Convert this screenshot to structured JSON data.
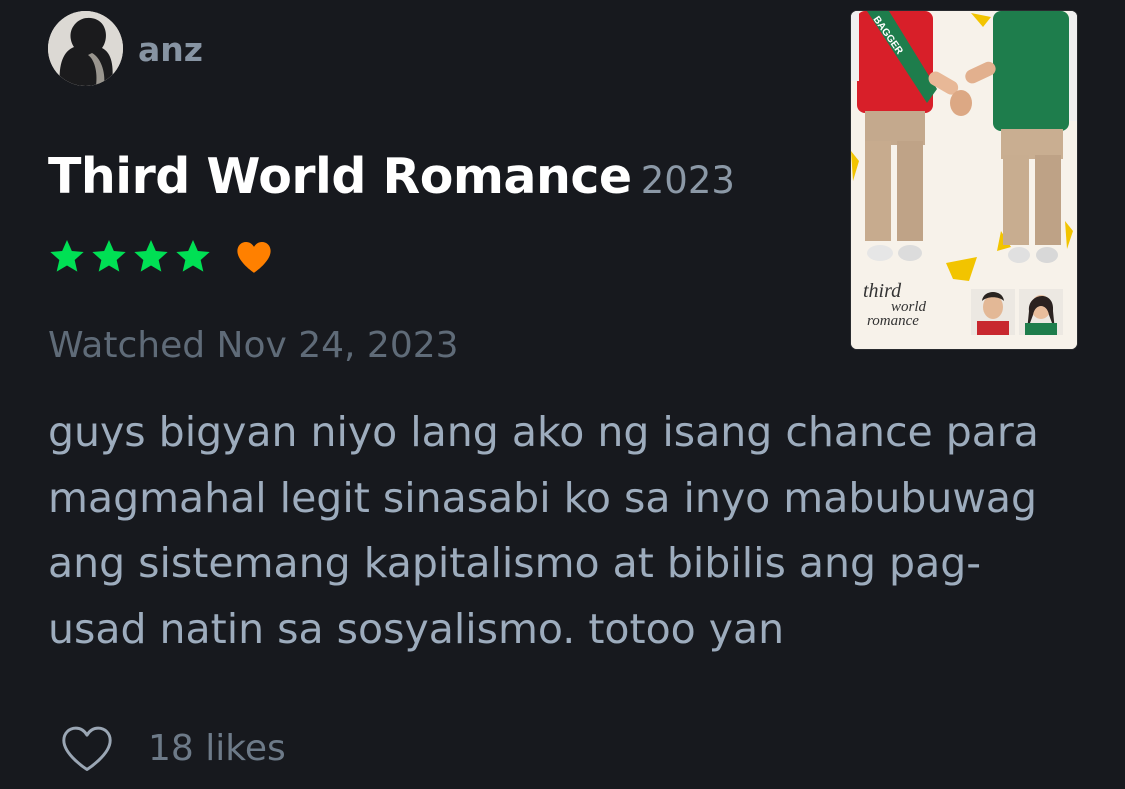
{
  "review": {
    "username": "anz",
    "film_title": "Third World Romance",
    "film_year": "2023",
    "rating_stars": 4,
    "liked_by_reviewer": true,
    "watched_text": "Watched Nov 24, 2023",
    "body_lines": [
      "guys bigyan niyo lang ako ng isang chance para",
      "magmahal legit sinasabi ko sa inyo mabubuwag",
      "ang sistemang kapitalismo at bibilis ang pag-",
      "usad natin sa sosyalismo. totoo yan"
    ],
    "likes_text": "18 likes"
  },
  "poster": {
    "sash_text": "BAGGER",
    "script_title_lines": [
      "third",
      "world",
      "romance"
    ]
  },
  "icons": {
    "star": "star-icon",
    "liked": "heart-filled-icon",
    "like_button": "heart-outline-icon"
  },
  "colors": {
    "background": "#17191e",
    "star_green": "#00e054",
    "heart_orange": "#ff8000",
    "muted_text": "#8794a3"
  }
}
